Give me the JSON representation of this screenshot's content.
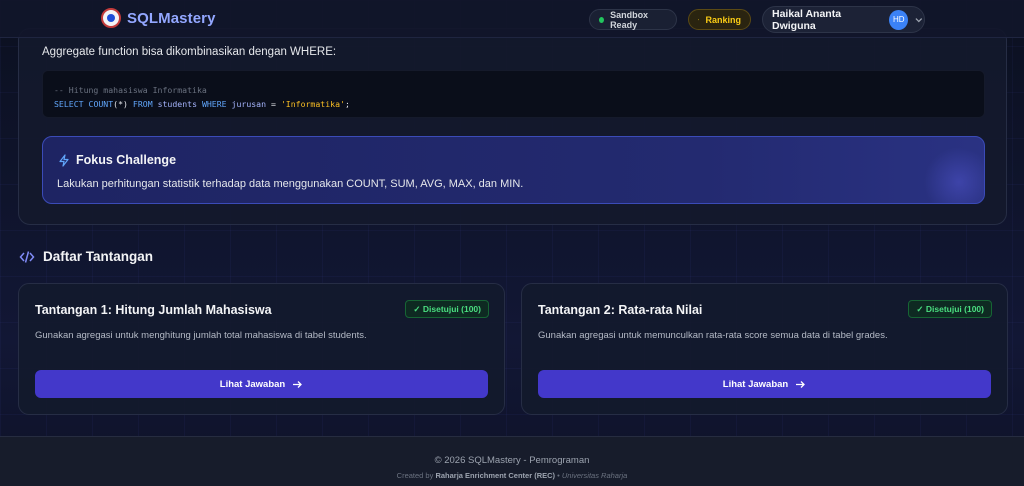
{
  "navbar": {
    "brand": "SQLMastery",
    "brand_icon": "university-seal-logo",
    "sandbox_status": "Sandbox Ready",
    "ranking_label": "Ranking",
    "user_name": "Haikal Ananta Dwiguna",
    "user_initials": "HD"
  },
  "lesson": {
    "intro": "Aggregate function bisa dikombinasikan dengan WHERE:",
    "code": {
      "comment": "-- Hitung mahasiswa Informatika",
      "select": "SELECT",
      "count": "COUNT",
      "count_args": "(*)",
      "from": "FROM",
      "table": "students",
      "where": "WHERE",
      "column": "jurusan",
      "op": "=",
      "value": "'Informatika'",
      "semi": ";"
    },
    "focus": {
      "icon": "lightning-icon",
      "title": "Fokus Challenge",
      "description": "Lakukan perhitungan statistik terhadap data menggunakan COUNT, SUM, AVG, MAX, dan MIN."
    }
  },
  "challenges_section": {
    "icon": "code-icon",
    "title": "Daftar Tantangan"
  },
  "challenges": [
    {
      "title": "Tantangan 1: Hitung Jumlah Mahasiswa",
      "badge": "✓ Disetujui (100)",
      "description": "Gunakan agregasi untuk menghitung jumlah total mahasiswa di tabel students.",
      "button": "Lihat Jawaban"
    },
    {
      "title": "Tantangan 2: Rata-rata Nilai",
      "badge": "✓ Disetujui (100)",
      "description": "Gunakan agregasi untuk memunculkan rata-rata score semua data di tabel grades.",
      "button": "Lihat Jawaban"
    }
  ],
  "footer": {
    "copyright": "© 2026 SQLMastery - Pemrograman",
    "created_by": "Created by",
    "org": "Raharja Enrichment Center (REC)",
    "separator": "•",
    "university": "Universitas Raharja"
  },
  "colors": {
    "accent": "#4338ca",
    "brand": "#93a7ff",
    "success": "#4ade80",
    "ranking": "#facc15"
  }
}
